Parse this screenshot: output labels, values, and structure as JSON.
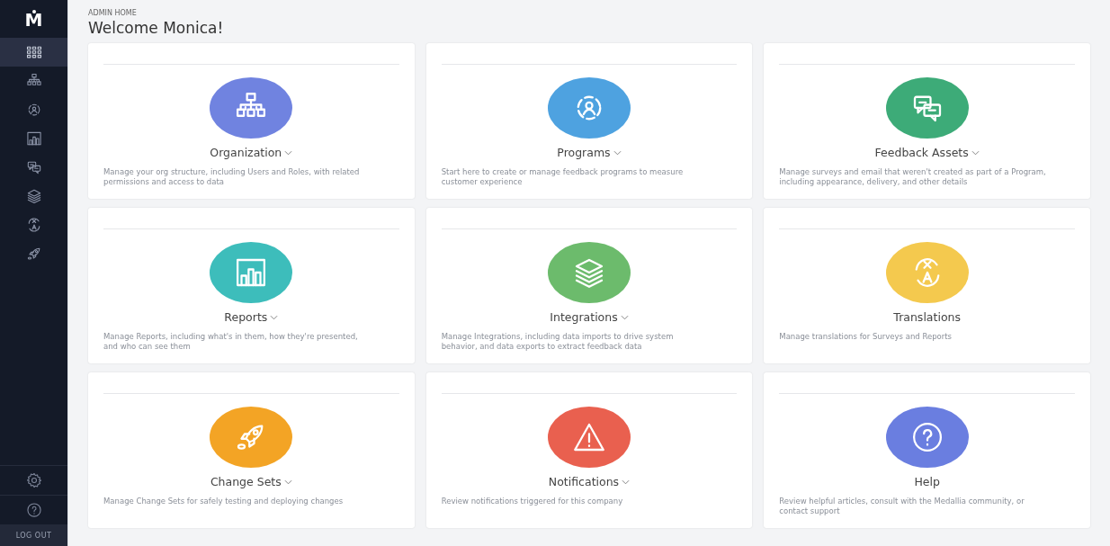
{
  "sidebar": {
    "logo": "M",
    "items": [
      {
        "kind": "grid",
        "selected": true
      },
      {
        "kind": "org",
        "selected": false
      },
      {
        "kind": "programs",
        "selected": false
      },
      {
        "kind": "reports",
        "selected": false
      },
      {
        "kind": "feedback",
        "selected": false
      },
      {
        "kind": "integrations",
        "selected": false
      },
      {
        "kind": "translations",
        "selected": false
      },
      {
        "kind": "rocket",
        "selected": false
      }
    ],
    "bottom": [
      {
        "kind": "settings"
      },
      {
        "kind": "help"
      }
    ],
    "logout": "LOG OUT"
  },
  "header": {
    "eyebrow": "ADMIN HOME",
    "title": "Welcome Monica!"
  },
  "cards": [
    {
      "title": "Organization",
      "has_menu": true,
      "kind": "org",
      "color": "#7083e0",
      "description": "Manage your org structure, including Users and Roles, with related permissions and access to data"
    },
    {
      "title": "Programs",
      "has_menu": true,
      "kind": "programs",
      "color": "#4ea2e0",
      "description": "Start here to create or manage feedback programs to measure customer experience"
    },
    {
      "title": "Feedback Assets",
      "has_menu": true,
      "kind": "feedback",
      "color": "#3dab78",
      "description": "Manage surveys and email that weren't created as part of a Program, including appearance, delivery, and other details"
    },
    {
      "title": "Reports",
      "has_menu": true,
      "kind": "reports",
      "color": "#3dbdbb",
      "description": "Manage Reports, including what's in them, how they're presented, and who can see them"
    },
    {
      "title": "Integrations",
      "has_menu": true,
      "kind": "integrations",
      "color": "#6cbb6c",
      "description": "Manage Integrations, including data imports to drive system behavior, and data exports to extract feedback data"
    },
    {
      "title": "Translations",
      "has_menu": false,
      "kind": "translations",
      "color": "#f4c94e",
      "description": "Manage translations for Surveys and Reports"
    },
    {
      "title": "Change Sets",
      "has_menu": true,
      "kind": "rocket",
      "color": "#f3a425",
      "description": "Manage Change Sets for safely testing and deploying changes"
    },
    {
      "title": "Notifications",
      "has_menu": true,
      "kind": "warning",
      "color": "#e9604f",
      "description": "Review notifications triggered for this company"
    },
    {
      "title": "Help",
      "has_menu": false,
      "kind": "help",
      "color": "#6a7ee0",
      "description": "Review helpful articles, consult with the Medallia community, or contact support"
    }
  ]
}
